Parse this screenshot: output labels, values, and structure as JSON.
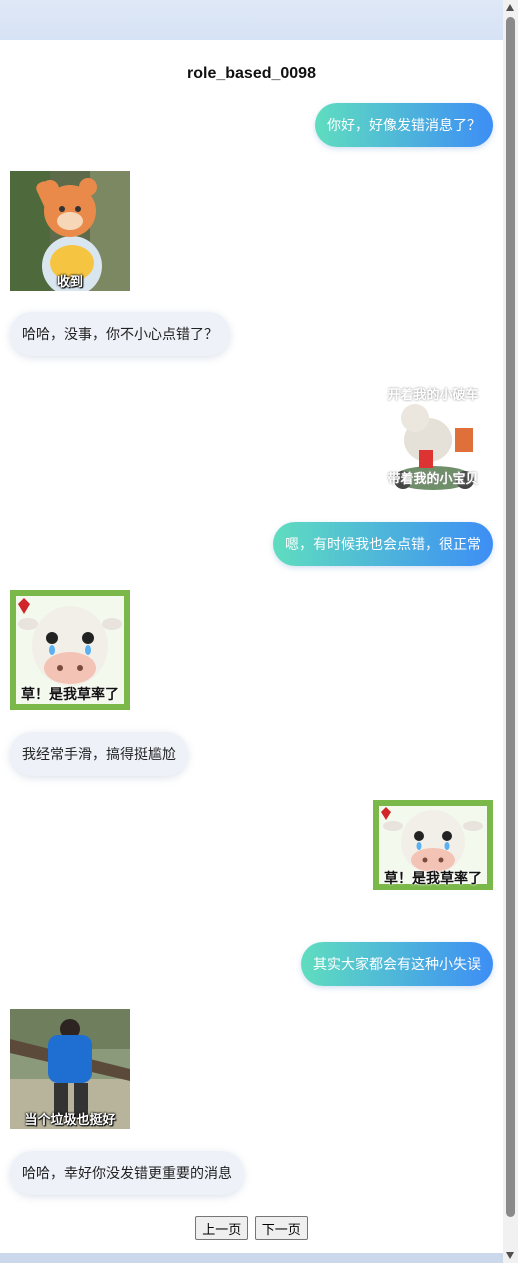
{
  "title": "role_based_0098",
  "messages": [
    {
      "side": "right",
      "type": "text",
      "text": "你好，好像发错消息了？"
    },
    {
      "side": "left",
      "type": "sticker",
      "icon": "orange-bear-salute",
      "caption": "收到"
    },
    {
      "side": "left",
      "type": "text",
      "text": "哈哈，没事，你不小心点错了？"
    },
    {
      "side": "right",
      "type": "sticker",
      "icon": "cat-on-scooter",
      "caption_top": "开着我的小破车",
      "caption_bottom": "带着我的小宝贝"
    },
    {
      "side": "right",
      "type": "text",
      "text": "嗯，有时候我也会点错，很正常"
    },
    {
      "side": "left",
      "type": "sticker",
      "icon": "crying-cow",
      "caption": "草！是我草率了"
    },
    {
      "side": "left",
      "type": "text",
      "text": "我经常手滑，搞得挺尴尬"
    },
    {
      "side": "right",
      "type": "sticker",
      "icon": "crying-cow",
      "caption": "草！是我草率了"
    },
    {
      "side": "right",
      "type": "text",
      "text": "其实大家都会有这种小失误"
    },
    {
      "side": "left",
      "type": "sticker",
      "icon": "man-blue-shirt",
      "caption": "当个垃圾也挺好"
    },
    {
      "side": "left",
      "type": "text",
      "text": "哈哈，幸好你没发错更重要的消息"
    }
  ],
  "pagination": {
    "prev_label": "上一页",
    "next_label": "下一页"
  },
  "colors": {
    "bubble_right_start": "#5fddbf",
    "bubble_right_end": "#3d8ef5",
    "bubble_left": "#eef2f8",
    "header_band": "#dfe8f7"
  }
}
